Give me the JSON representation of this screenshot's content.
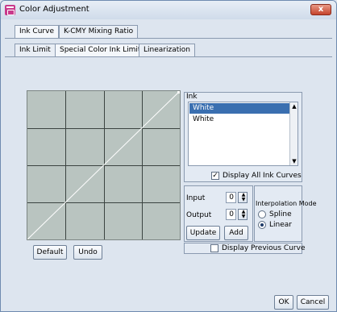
{
  "window": {
    "title": "Color Adjustment",
    "close_label": "x"
  },
  "top_tabs": [
    {
      "label": "Ink Curve",
      "active": true
    },
    {
      "label": "K-CMY Mixing Ratio",
      "active": false
    }
  ],
  "sub_tabs": [
    {
      "label": "Ink Limit",
      "active": false
    },
    {
      "label": "Special Color Ink Limit",
      "active": true
    },
    {
      "label": "Linearization",
      "active": false
    }
  ],
  "graph": {
    "grid_divisions": 4,
    "curve": "linear identity"
  },
  "graph_buttons": {
    "default_label": "Default",
    "undo_label": "Undo"
  },
  "ink_panel": {
    "title": "Ink",
    "items": [
      {
        "label": "White",
        "selected": true
      },
      {
        "label": "White",
        "selected": false
      }
    ],
    "display_all_label": "Display All Ink Curves",
    "display_all_checked": true
  },
  "io_panel": {
    "input_label": "Input",
    "input_value": "0",
    "output_label": "Output",
    "output_value": "0",
    "update_label": "Update",
    "add_label": "Add"
  },
  "interpolation": {
    "title": "Interpolation Mode",
    "spline_label": "Spline",
    "linear_label": "Linear",
    "selected": "Linear"
  },
  "display_previous": {
    "label": "Display Previous Curve",
    "checked": false
  },
  "footer": {
    "ok_label": "OK",
    "cancel_label": "Cancel"
  },
  "colors": {
    "selection": "#3a6fb0",
    "graph_bg": "#b9c4c0",
    "close_red": "#c4432c"
  }
}
